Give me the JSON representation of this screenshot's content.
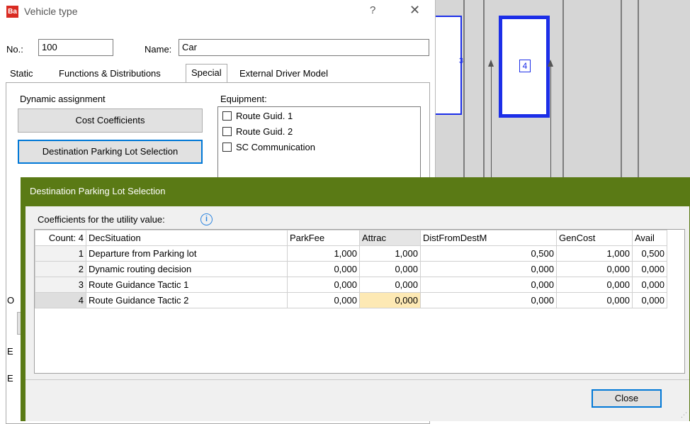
{
  "vehicle_dialog": {
    "title": "Vehicle type",
    "help": "?",
    "close": "✕",
    "no_label": "No.:",
    "no_value": "100",
    "name_label": "Name:",
    "name_value": "Car",
    "tabs": [
      "Static",
      "Functions & Distributions",
      "Special",
      "External Driver Model"
    ],
    "active_tab": "Special",
    "dynamic_assignment_label": "Dynamic assignment",
    "cost_coefficients_button": "Cost Coefficients",
    "destination_parking_button": "Destination Parking Lot Selection",
    "equipment_label": "Equipment:",
    "equipment_items": [
      "Route Guid. 1",
      "Route Guid. 2",
      "SC Communication"
    ],
    "partial_labels": [
      "O",
      "E",
      "E"
    ]
  },
  "network_view": {
    "vehicle_label": "4",
    "partial_label": "3"
  },
  "parking_dialog": {
    "title": "Destination Parking Lot Selection",
    "coefficients_label": "Coefficients for the utility value:",
    "info_icon": "i",
    "columns": [
      "Count: 4",
      "DecSituation",
      "ParkFee",
      "Attrac",
      "DistFromDestM",
      "GenCost",
      "Avail"
    ],
    "rows": [
      {
        "idx": "1",
        "situation": "Departure from Parking lot",
        "parkfee": "1,000",
        "attrac": "1,000",
        "dist": "0,500",
        "gencost": "1,000",
        "avail": "0,500"
      },
      {
        "idx": "2",
        "situation": "Dynamic routing decision",
        "parkfee": "0,000",
        "attrac": "0,000",
        "dist": "0,000",
        "gencost": "0,000",
        "avail": "0,000"
      },
      {
        "idx": "3",
        "situation": "Route Guidance Tactic 1",
        "parkfee": "0,000",
        "attrac": "0,000",
        "dist": "0,000",
        "gencost": "0,000",
        "avail": "0,000"
      },
      {
        "idx": "4",
        "situation": "Route Guidance Tactic 2",
        "parkfee": "0,000",
        "attrac": "0,000",
        "dist": "0,000",
        "gencost": "0,000",
        "avail": "0,000"
      }
    ],
    "close_button": "Close"
  },
  "colors": {
    "title_green": "#5a7a15",
    "focus_blue": "#0078d7",
    "highlight_cell": "#fde9b4",
    "vehicle_blue": "#1c2ee8"
  }
}
